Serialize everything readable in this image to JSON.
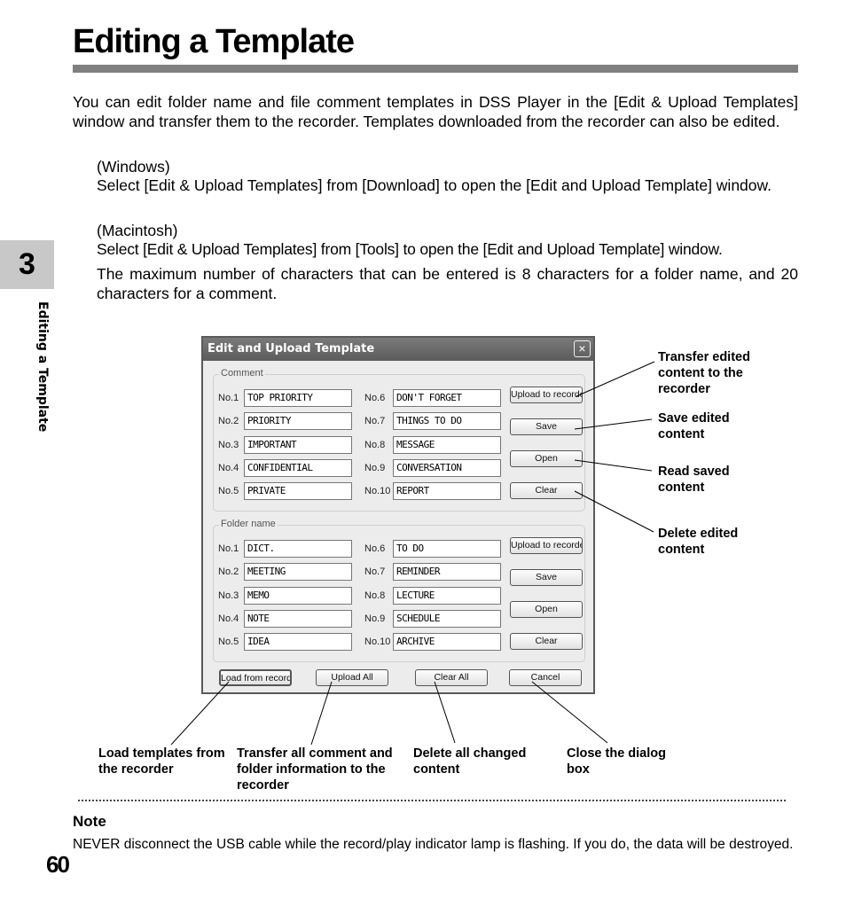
{
  "page": {
    "title": "Editing a Template",
    "chapter_number": "3",
    "chapter_side_label": "Editing a Template",
    "page_number": "60",
    "intro": "You can edit folder name and file comment templates in DSS Player in the [Edit & Upload Templates] window and transfer them to the recorder. Templates downloaded from the recorder can also be edited.",
    "windows_heading": "(Windows)",
    "windows_body": "Select [Edit & Upload Templates] from [Download] to open the [Edit and Upload Template] window.",
    "mac_heading": "(Macintosh)",
    "mac_body": "Select [Edit & Upload Templates] from [Tools] to open the [Edit and Upload Template] window.",
    "max_chars": "The maximum number of characters that can be entered is 8 characters for a folder name, and 20 characters for a comment.",
    "note_heading": "Note",
    "note_body": "NEVER disconnect the USB cable while the record/play indicator lamp is flashing. If you do, the data will be destroyed."
  },
  "dialog": {
    "title": "Edit and Upload Template",
    "close_icon": "×",
    "comment": {
      "label": "Comment",
      "rows": [
        {
          "label": "No.1",
          "value": "TOP PRIORITY"
        },
        {
          "label": "No.2",
          "value": "PRIORITY"
        },
        {
          "label": "No.3",
          "value": "IMPORTANT"
        },
        {
          "label": "No.4",
          "value": "CONFIDENTIAL"
        },
        {
          "label": "No.5",
          "value": "PRIVATE"
        },
        {
          "label": "No.6",
          "value": "DON'T FORGET"
        },
        {
          "label": "No.7",
          "value": "THINGS TO DO"
        },
        {
          "label": "No.8",
          "value": "MESSAGE"
        },
        {
          "label": "No.9",
          "value": "CONVERSATION"
        },
        {
          "label": "No.10",
          "value": "REPORT"
        }
      ],
      "buttons": {
        "upload": "Upload to recorder",
        "save": "Save",
        "open": "Open",
        "clear": "Clear"
      }
    },
    "folder": {
      "label": "Folder name",
      "rows": [
        {
          "label": "No.1",
          "value": "DICT."
        },
        {
          "label": "No.2",
          "value": "MEETING"
        },
        {
          "label": "No.3",
          "value": "MEMO"
        },
        {
          "label": "No.4",
          "value": "NOTE"
        },
        {
          "label": "No.5",
          "value": "IDEA"
        },
        {
          "label": "No.6",
          "value": "TO DO"
        },
        {
          "label": "No.7",
          "value": "REMINDER"
        },
        {
          "label": "No.8",
          "value": "LECTURE"
        },
        {
          "label": "No.9",
          "value": "SCHEDULE"
        },
        {
          "label": "No.10",
          "value": "ARCHIVE"
        }
      ],
      "buttons": {
        "upload": "Upload to recorder",
        "save": "Save",
        "open": "Open",
        "clear": "Clear"
      }
    },
    "bottom_buttons": {
      "load": "Load from recorder",
      "upload_all": "Upload All",
      "clear_all": "Clear All",
      "cancel": "Cancel"
    }
  },
  "callouts": {
    "upload": "Transfer edited content to the recorder",
    "save": "Save edited content",
    "open": "Read saved content",
    "clear": "Delete edited content",
    "load": "Load templates from the recorder",
    "upload_all": "Transfer all comment and folder information to the recorder",
    "clear_all": "Delete all changed content",
    "cancel": "Close the dialog box"
  }
}
